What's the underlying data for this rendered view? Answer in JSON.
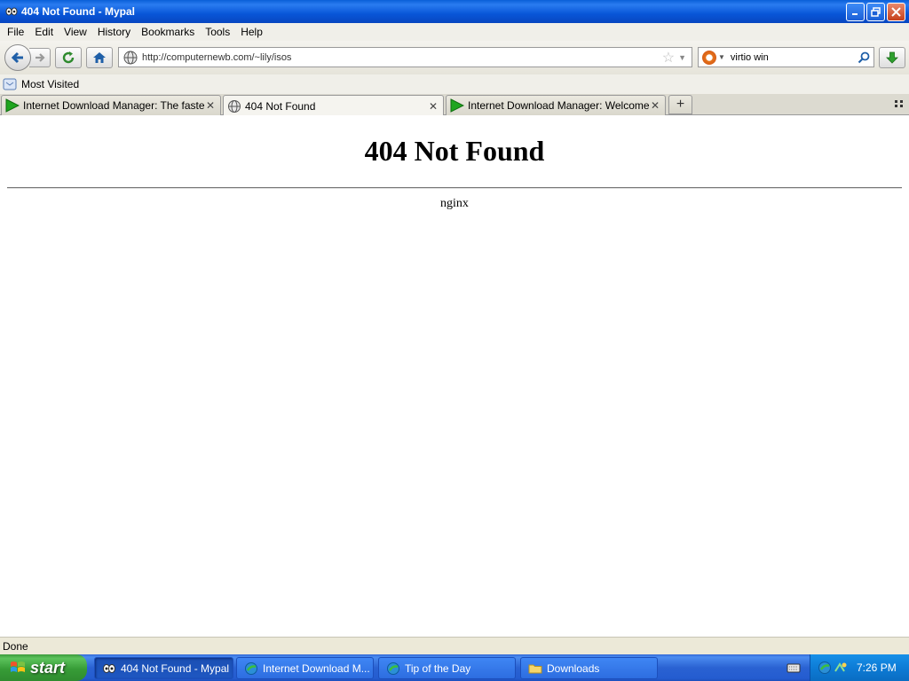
{
  "window": {
    "title": "404 Not Found - Mypal"
  },
  "menu": {
    "items": [
      "File",
      "Edit",
      "View",
      "History",
      "Bookmarks",
      "Tools",
      "Help"
    ]
  },
  "navigation": {
    "url": "http://computernewb.com/~lily/isos",
    "search_value": "virtio win",
    "back_icon": "back-arrow-icon",
    "forward_icon": "forward-arrow-icon",
    "reload_icon": "reload-icon",
    "home_icon": "home-icon"
  },
  "bookmarks": {
    "items": [
      "Most Visited"
    ]
  },
  "tabs": [
    {
      "label": "Internet Download Manager: The fastest d...",
      "active": false
    },
    {
      "label": "404 Not Found",
      "active": true
    },
    {
      "label": "Internet Download Manager: Welcome to ...",
      "active": false
    }
  ],
  "page": {
    "heading": "404 Not Found",
    "server": "nginx"
  },
  "status": {
    "text": "Done"
  },
  "taskbar": {
    "start_label": "start",
    "tasks": [
      {
        "label": "404 Not Found - Mypal",
        "active": true
      },
      {
        "label": "Internet Download M...",
        "active": false
      },
      {
        "label": "Tip of the Day",
        "active": false
      },
      {
        "label": "Downloads",
        "active": false
      }
    ],
    "clock": "7:26 PM"
  },
  "colors": {
    "titlebar": "#0856d8",
    "taskbar": "#245cd0",
    "start_button": "#379c37",
    "page_background": "#ffffff"
  }
}
